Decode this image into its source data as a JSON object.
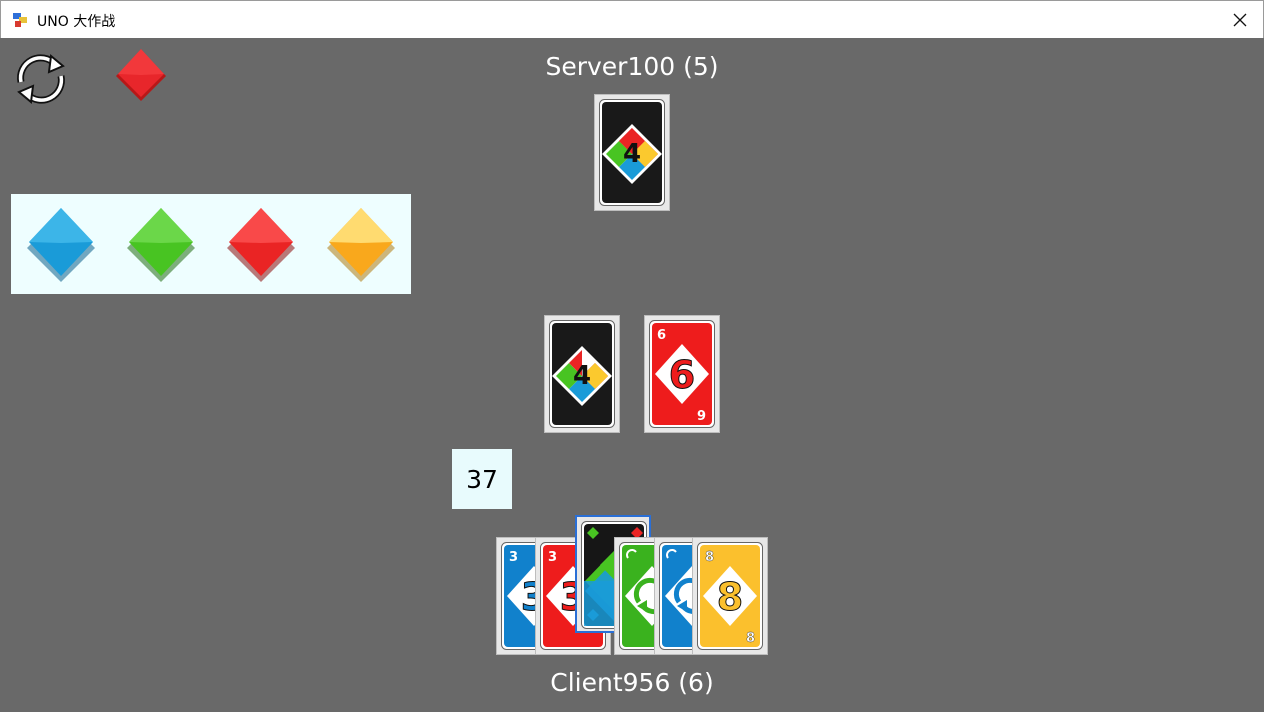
{
  "window": {
    "title": "UNO 大作战"
  },
  "opponent": {
    "name": "Server100",
    "card_count": "(5)",
    "label": "Server100 (5)"
  },
  "player": {
    "name": "Client956",
    "card_count": "(6)",
    "label": "Client956 (6)"
  },
  "current_color": "#e8262b",
  "deck_remaining": "37",
  "color_choices": [
    {
      "name": "blue",
      "color": "#1a9bd8"
    },
    {
      "name": "green",
      "color": "#48c422"
    },
    {
      "name": "red",
      "color": "#ea2424"
    },
    {
      "name": "yellow",
      "color": "#fbc92e"
    }
  ],
  "opponent_card": {
    "type": "wild-draw-four",
    "label": "4"
  },
  "pile": [
    {
      "type": "wild-draw-four",
      "label": "4"
    },
    {
      "type": "number",
      "color": "red",
      "value": "6"
    }
  ],
  "hand": [
    {
      "type": "number",
      "color": "blue",
      "value": "3"
    },
    {
      "type": "number",
      "color": "red",
      "value": "3"
    },
    {
      "type": "wild",
      "selected": true
    },
    {
      "type": "reverse",
      "color": "green"
    },
    {
      "type": "reverse",
      "color": "blue"
    },
    {
      "type": "number",
      "color": "yellow",
      "value": "8"
    }
  ]
}
